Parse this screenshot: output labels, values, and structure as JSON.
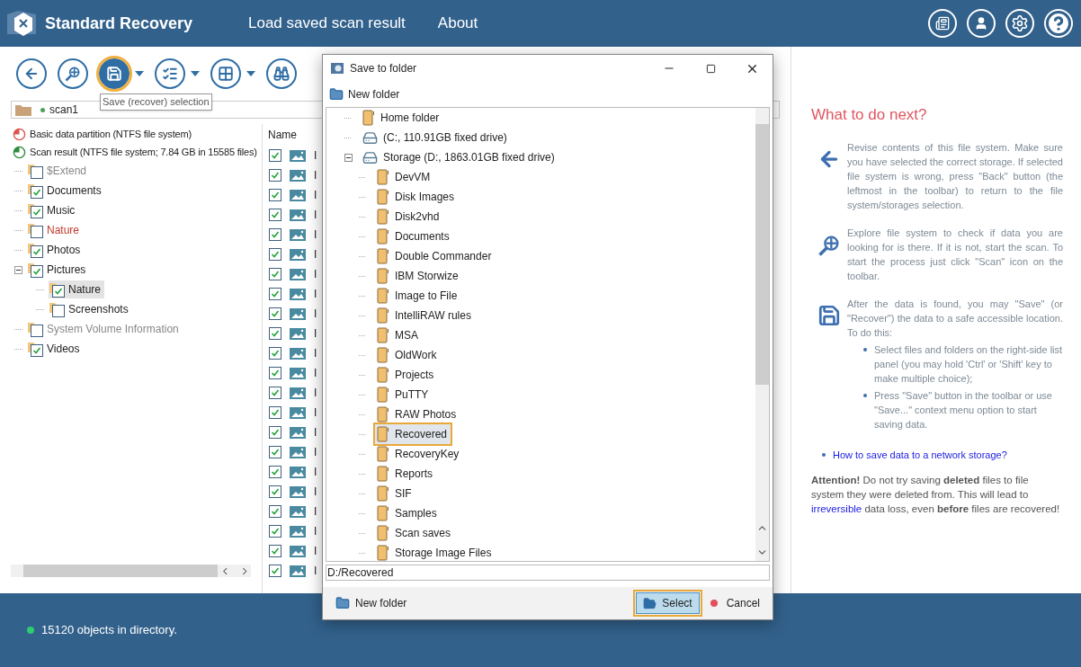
{
  "header": {
    "app_name": "Standard Recovery",
    "nav": [
      "Load saved scan result",
      "About"
    ]
  },
  "toolbar": {
    "tooltip": "Save (recover) selection",
    "buttons": [
      {
        "kind": "back",
        "selected": false,
        "menu": false
      },
      {
        "kind": "scan",
        "selected": false,
        "menu": false
      },
      {
        "kind": "save",
        "selected": true,
        "menu": true
      },
      {
        "kind": "select",
        "selected": false,
        "menu": true
      },
      {
        "kind": "view",
        "selected": false,
        "menu": true
      },
      {
        "kind": "find",
        "selected": false,
        "menu": false
      }
    ]
  },
  "breadcrumb": [
    "scan1"
  ],
  "partitions": [
    {
      "label": "Basic data partition (NTFS file system)",
      "color": "#d9534f"
    },
    {
      "label": "Scan result (NTFS file system; 7.84 GB in 15585 files)",
      "color": "#2e8b3e"
    }
  ],
  "folders": [
    {
      "label": "$Extend",
      "kind": "system",
      "checked": false,
      "selected": false
    },
    {
      "label": "Documents",
      "kind": "normal",
      "checked": true,
      "selected": false
    },
    {
      "label": "Music",
      "kind": "normal",
      "checked": true,
      "selected": false
    },
    {
      "label": "Nature",
      "kind": "deleted",
      "checked": false,
      "selected": false
    },
    {
      "label": "Photos",
      "kind": "normal",
      "checked": true,
      "selected": false
    },
    {
      "label": "Pictures",
      "kind": "normal",
      "checked": true,
      "selected": false,
      "expanded": true,
      "children": [
        {
          "label": "Nature",
          "kind": "normal",
          "checked": true,
          "selected": true
        },
        {
          "label": "Screenshots",
          "kind": "normal",
          "checked": false,
          "selected": false
        }
      ]
    },
    {
      "label": "System Volume Information",
      "kind": "system",
      "checked": false,
      "selected": false
    },
    {
      "label": "Videos",
      "kind": "normal",
      "checked": true,
      "selected": false
    }
  ],
  "file_list": {
    "column": "Name",
    "rows": [
      {
        "name": "I",
        "checked": true
      },
      {
        "name": "I",
        "checked": true
      },
      {
        "name": "I",
        "checked": true
      },
      {
        "name": "I",
        "checked": true
      },
      {
        "name": "I",
        "checked": true
      },
      {
        "name": "I",
        "checked": true
      },
      {
        "name": "I",
        "checked": true
      },
      {
        "name": "I",
        "checked": true
      },
      {
        "name": "I",
        "checked": true
      },
      {
        "name": "I",
        "checked": true
      },
      {
        "name": "I",
        "checked": true
      },
      {
        "name": "I",
        "checked": true
      },
      {
        "name": "I",
        "checked": true
      },
      {
        "name": "I",
        "checked": true
      },
      {
        "name": "I",
        "checked": true
      },
      {
        "name": "I",
        "checked": true
      },
      {
        "name": "I",
        "checked": true
      },
      {
        "name": "I",
        "checked": true
      },
      {
        "name": "I",
        "checked": true
      },
      {
        "name": "I",
        "checked": true
      },
      {
        "name": "I",
        "checked": true
      },
      {
        "name": "I",
        "checked": true
      }
    ]
  },
  "dialog": {
    "title": "Save to folder",
    "toolbar_button": "New folder",
    "tree": [
      {
        "kind": "folder",
        "label": "Home folder",
        "selected": false
      },
      {
        "kind": "drive",
        "label": "(C:, 110.91GB fixed drive)",
        "selected": false
      },
      {
        "kind": "drive",
        "label": "Storage (D:, 1863.01GB fixed drive)",
        "selected": false,
        "expanded": true,
        "children": [
          {
            "kind": "folder",
            "label": "DevVM",
            "selected": false
          },
          {
            "kind": "folder",
            "label": "Disk Images",
            "selected": false
          },
          {
            "kind": "folder",
            "label": "Disk2vhd",
            "selected": false
          },
          {
            "kind": "folder",
            "label": "Documents",
            "selected": false
          },
          {
            "kind": "folder",
            "label": "Double Commander",
            "selected": false
          },
          {
            "kind": "folder",
            "label": "IBM Storwize",
            "selected": false
          },
          {
            "kind": "folder",
            "label": "Image to File",
            "selected": false
          },
          {
            "kind": "folder",
            "label": "IntelliRAW rules",
            "selected": false
          },
          {
            "kind": "folder",
            "label": "MSA",
            "selected": false
          },
          {
            "kind": "folder",
            "label": "OldWork",
            "selected": false
          },
          {
            "kind": "folder",
            "label": "Projects",
            "selected": false
          },
          {
            "kind": "folder",
            "label": "PuTTY",
            "selected": false
          },
          {
            "kind": "folder",
            "label": "RAW Photos",
            "selected": false
          },
          {
            "kind": "folder",
            "label": "Recovered",
            "selected": true
          },
          {
            "kind": "folder",
            "label": "RecoveryKey",
            "selected": false
          },
          {
            "kind": "folder",
            "label": "Reports",
            "selected": false
          },
          {
            "kind": "folder",
            "label": "SIF",
            "selected": false
          },
          {
            "kind": "folder",
            "label": "Samples",
            "selected": false
          },
          {
            "kind": "folder",
            "label": "Scan saves",
            "selected": false
          },
          {
            "kind": "folder",
            "label": "Storage Image Files",
            "selected": false
          }
        ]
      }
    ],
    "path": "D:/Recovered",
    "new_folder": "New folder",
    "select": "Select",
    "cancel": "Cancel"
  },
  "help": {
    "title": "What to do next?",
    "steps": [
      {
        "kind": "back",
        "text": "Revise contents of this file system. Make sure you have selected the correct storage. If selected file system is wrong, press \"Back\" button (the leftmost in the toolbar) to return to the file system/storages selection."
      },
      {
        "kind": "scan",
        "text": "Explore file system to check if data you are looking for is there. If it is not, start the scan. To start the process just click \"Scan\" icon on the toolbar."
      },
      {
        "kind": "save",
        "text": "After the data is found, you may \"Save\" (or \"Recover\") the data to a safe accessible location. To do this:",
        "bullets": [
          "Select files and folders on the right-side list panel (you may hold 'Ctrl' or 'Shift' key to make multiple choice);",
          "Press \"Save\" button in the toolbar or use \"Save...\" context menu option to start saving data."
        ]
      }
    ],
    "link": "How to save data to a network storage?",
    "attention": {
      "before": "**Attention!** Do not try saving **deleted** files to file system they were deleted from. This will lead to",
      "link": "irreversible",
      "after": "data loss, even **before** files are recovered!"
    }
  },
  "status_bar": {
    "text": "15120 objects in directory."
  }
}
